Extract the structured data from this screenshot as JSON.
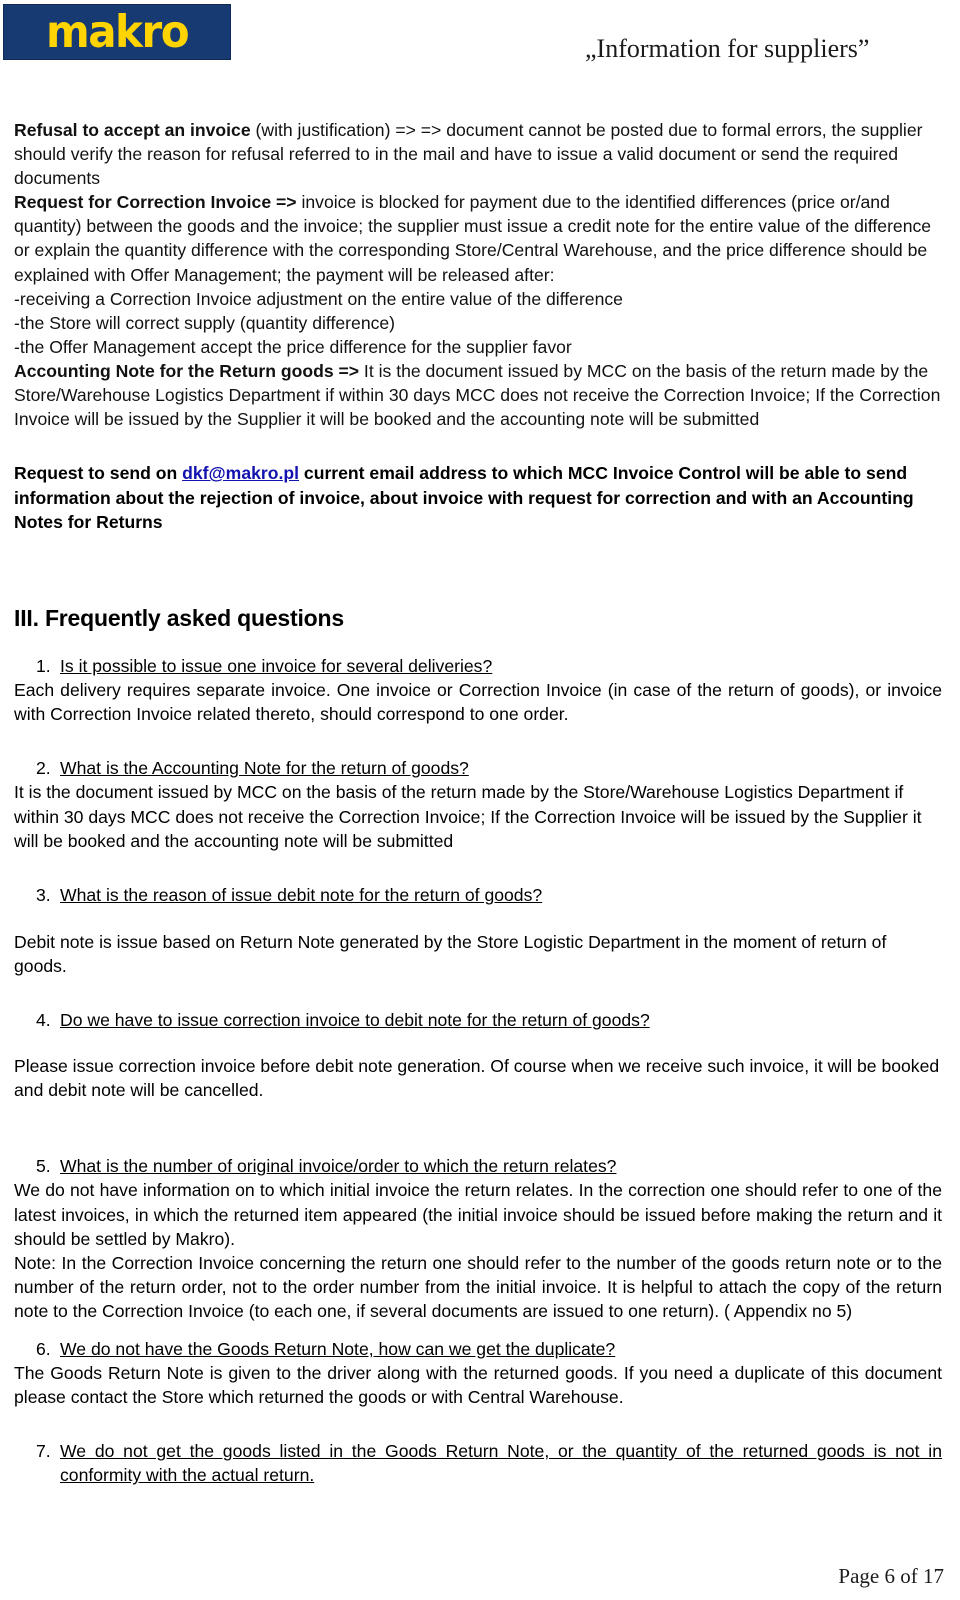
{
  "header": {
    "logo_text": "makro",
    "logo_bg_color": "#173A72",
    "logo_text_color": "#FFD400",
    "title": "„Information for suppliers”"
  },
  "body": {
    "refusal_bold": "Refusal to accept an invoice",
    "refusal_rest": " (with justification) => => document cannot be posted due to formal errors, the supplier should verify the reason for refusal referred to in the mail and have to issue a valid document or send the required documents",
    "correction_bold": "Request for Correction Invoice =>",
    "correction_rest": " invoice is blocked for payment due to the identified differences (price or/and quantity) between the goods and the invoice; the supplier must issue a credit note for the entire value of the difference or explain the quantity difference with the corresponding Store/Central Warehouse, and the price difference should be explained with Offer Management; the payment will be released after:",
    "bullet_1": "-receiving a Correction Invoice adjustment on the entire value of the difference",
    "bullet_2": "-the Store will correct supply (quantity difference)",
    "bullet_3": "-the Offer Management accept the price difference for the supplier favor",
    "accounting_bold": "Accounting Note for the Return goods =>",
    "accounting_rest": " It is the document issued by MCC on the basis of the return made by the Store/Warehouse Logistics Department  if within 30 days MCC does not receive the Correction Invoice; If the Correction Invoice will be issued by the Supplier it will be booked and the accounting note will be submitted",
    "email_prefix": "Request to send on ",
    "email_link": "dkf@makro.pl",
    "email_link_color": "#1212b0",
    "email_suffix": " current email address to which MCC Invoice Control will be able to send information about the rejection of invoice, about invoice with request for correction and with an Accounting Notes for Returns"
  },
  "faq": {
    "heading": "III. Frequently asked questions",
    "items": [
      {
        "number": "1.",
        "question": "Is it possible to issue one invoice for several deliveries?",
        "answer": "Each delivery requires separate invoice. One invoice or Correction Invoice (in case of the return of goods), or invoice with Correction Invoice related thereto, should correspond to one order."
      },
      {
        "number": "2.",
        "question": "What is the Accounting Note for the return of goods?",
        "answer": "It is the document issued by MCC on the basis of the return made by the Store/Warehouse Logistics Department  if within 30 days MCC does not receive the Correction Invoice; If the Correction Invoice will be issued by the Supplier it will be booked and the accounting note will be submitted"
      },
      {
        "number": "3.",
        "question": "What is the reason of issue debit note for the return of goods?",
        "answer": "Debit note is issue based on Return Note generated by the Store Logistic Department in the moment of return of goods."
      },
      {
        "number": "4.",
        "question": "Do we have to issue correction invoice to debit note for the return of goods?",
        "answer": "Please issue correction invoice before debit note generation. Of course when we receive such invoice, it will be booked and debit note will be cancelled."
      },
      {
        "number": "5.",
        "question": "What is the number of original invoice/order to which the return relates?",
        "answer": "We do not have information on to which initial invoice the return relates. In the correction one should refer to one of the latest invoices, in which the returned item appeared (the initial invoice should be issued before making the return and it should be settled by Makro).",
        "answer_2": "Note: In the Correction Invoice concerning the return one should refer to the number of the goods return note or to the number of the return order, not to the order number from the initial invoice. It is helpful to attach the copy of the return note to the Correction Invoice (to each one, if several documents are issued to one return). ( Appendix no 5)"
      },
      {
        "number": "6.",
        "question": "We do not have the Goods Return Note, how can we get the duplicate?",
        "answer": "The Goods Return Note is given to the driver along with the returned goods. If you need a duplicate of this document please contact the Store which returned the goods or with Central Warehouse."
      },
      {
        "number": "7.",
        "question": "We do not get the goods listed in the Goods Return Note, or the quantity of the returned goods is not in conformity with the actual return.",
        "answer": ""
      }
    ]
  },
  "footer": {
    "page_label": "Page 6 of 17"
  }
}
